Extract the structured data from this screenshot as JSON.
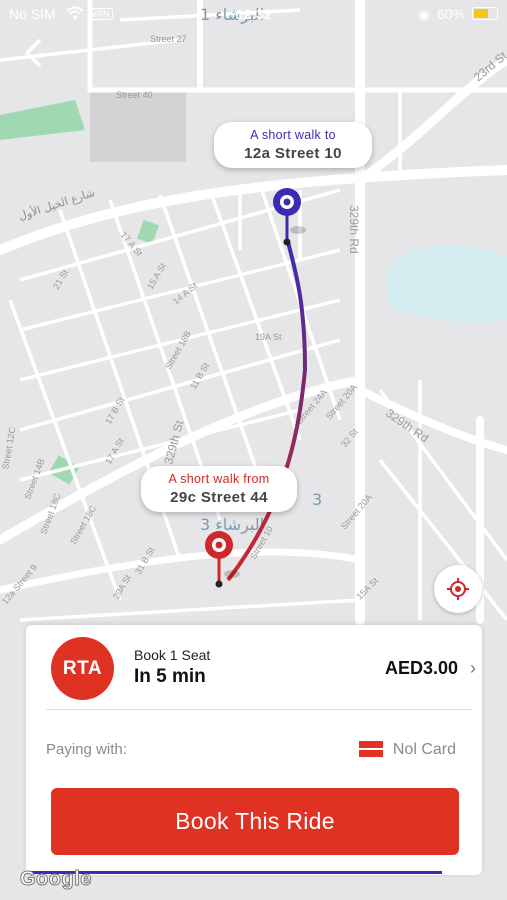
{
  "status": {
    "carrier": "No SIM",
    "vpn": "VPN",
    "time": "12:32",
    "battery": "60%"
  },
  "map": {
    "street_labels": [
      "Street 27",
      "Street 40",
      "23rd St",
      "329th Rd",
      "329th Rd",
      "17 A St",
      "21 St",
      "14 A St",
      "15 A St",
      "19A St",
      "Street 18B",
      "11 B St",
      "17 B St",
      "Street 12C",
      "17 A St",
      "Street 14B",
      "Street 18C",
      "Street 18C",
      "Street 20A",
      "Street 20A",
      "Street 24A",
      "Street 10",
      "31 B St",
      "20A St",
      "15A St",
      "32 St",
      "329th St",
      "12a Street 9"
    ],
    "arabic_labels": [
      "البرشاء 1",
      "شارع الخيل الأول",
      "البرشاء 3"
    ],
    "district_numbers": [
      "3",
      "3"
    ]
  },
  "pins": {
    "dest": {
      "line1": "A short walk to",
      "line2": "12a Street 10",
      "color": "#3a2cb0"
    },
    "origin": {
      "line1": "A short walk from",
      "line2": "29c Street 44",
      "color": "#e03223"
    }
  },
  "ride": {
    "logo": "RTA",
    "title": "Book 1 Seat",
    "eta": "In 5 min",
    "price": "AED3.00",
    "paying_label": "Paying with:",
    "payment_method": "Nol Card",
    "book_label": "Book This Ride"
  },
  "google": "Google"
}
